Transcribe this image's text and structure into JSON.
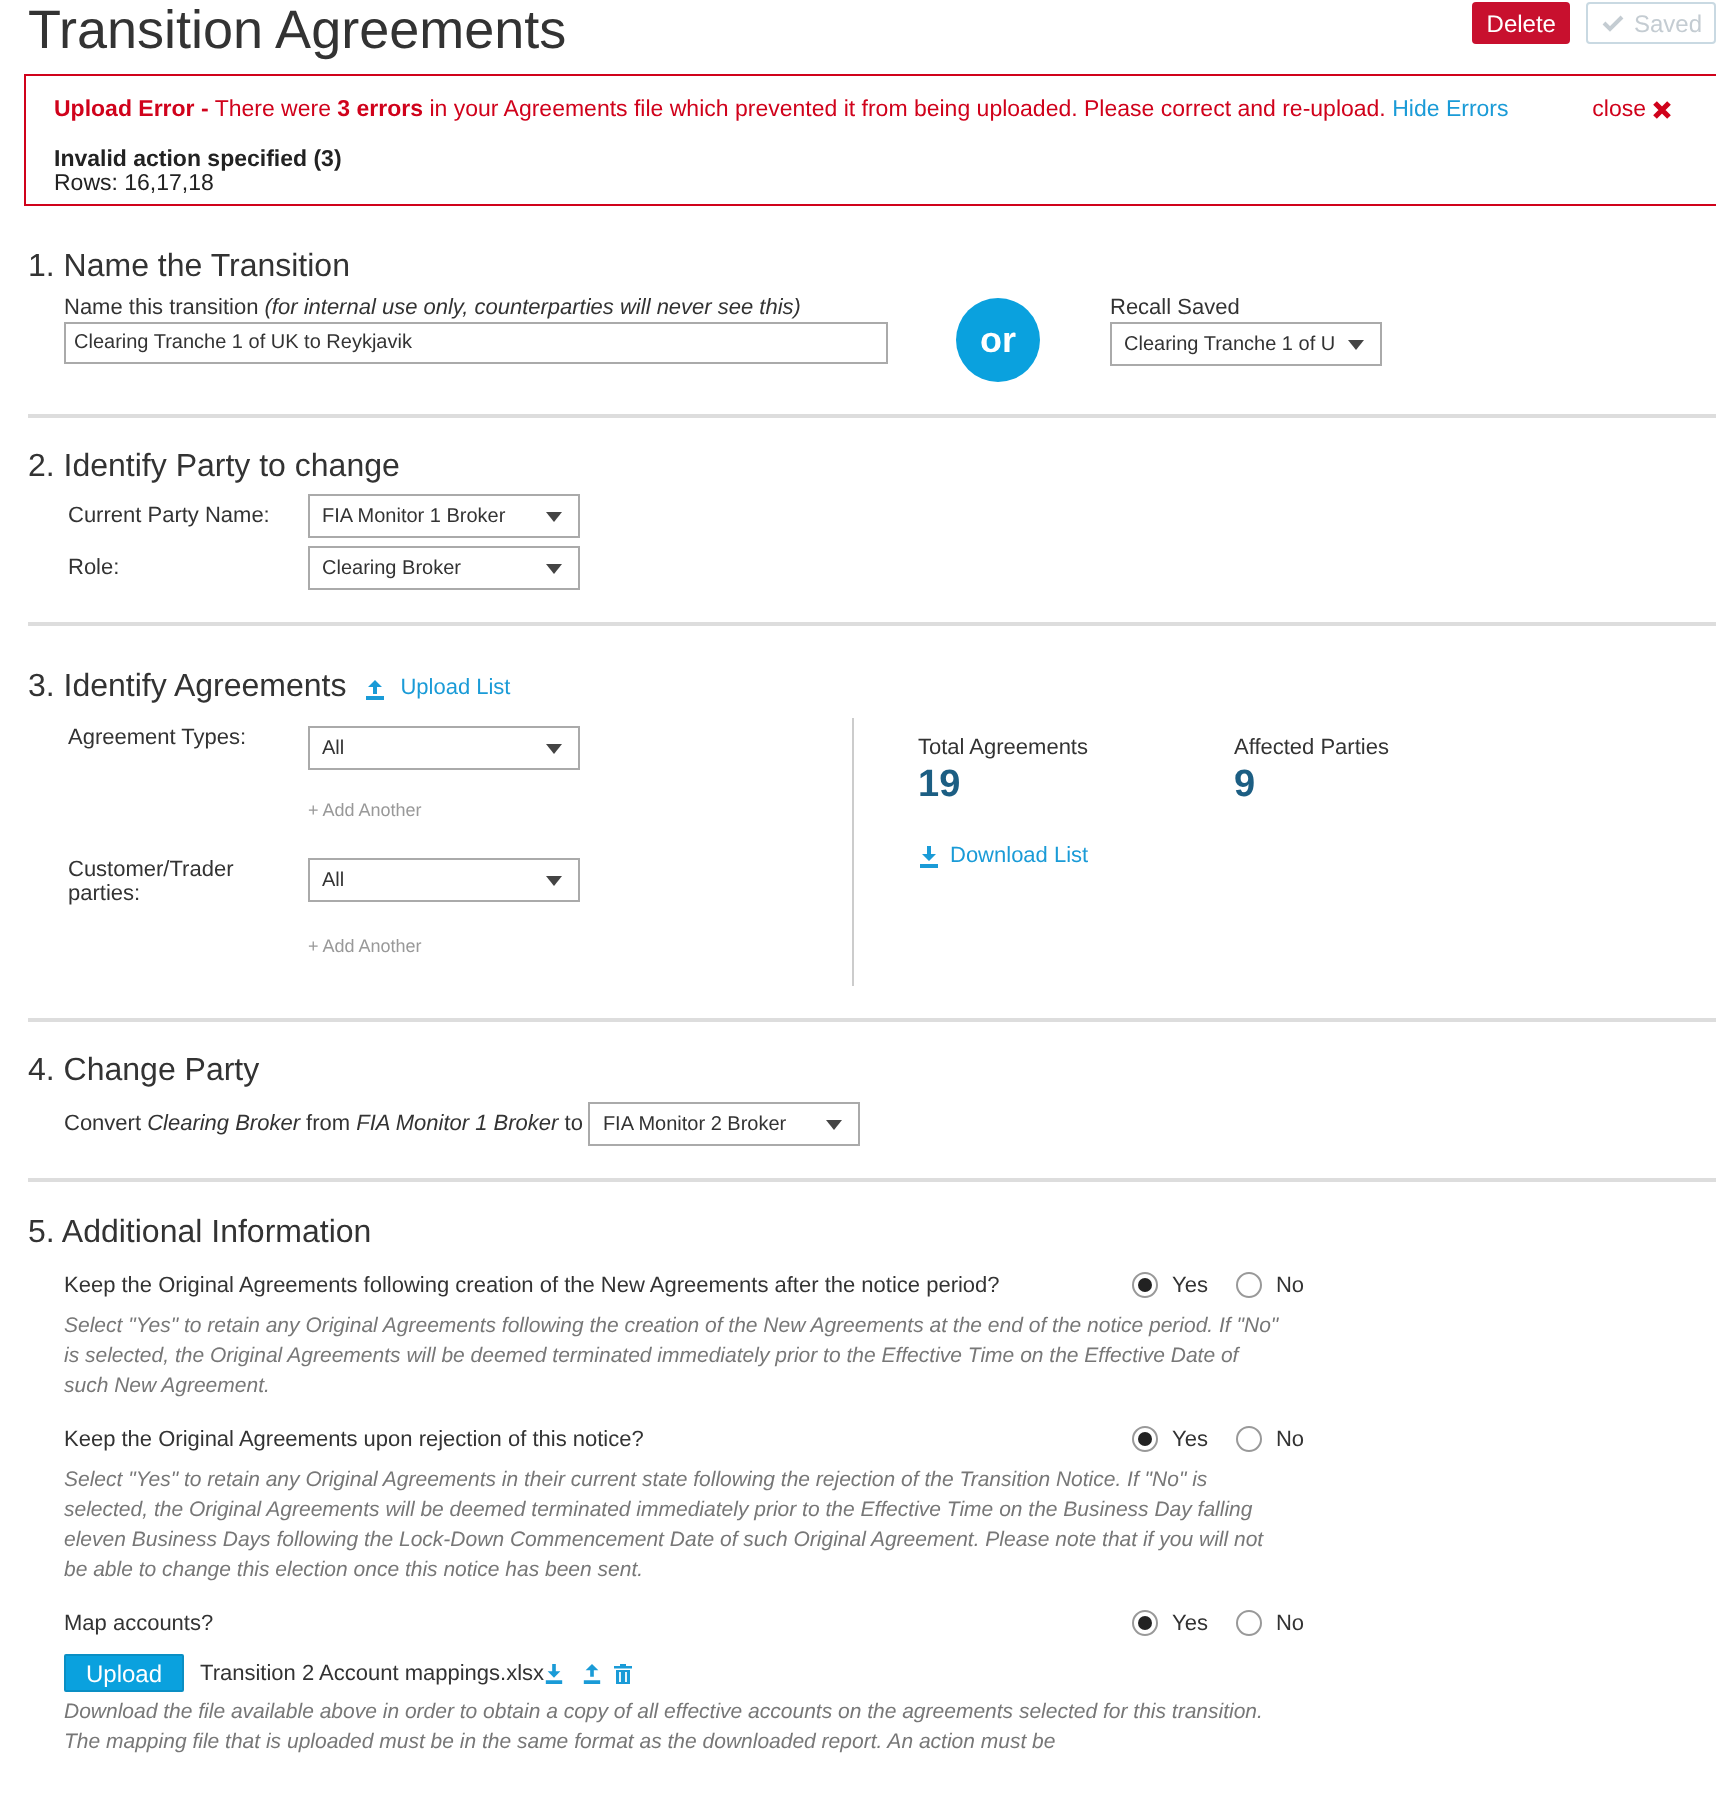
{
  "header": {
    "title": "Transition Agreements",
    "delete_button": "Delete",
    "saved_button": {
      "label": "Saved",
      "disabled": true
    }
  },
  "error": {
    "prefix": "Upload Error -",
    "message": "There were **3 errors** in your Agreements file which prevented it from being uploaded. Please correct and re-upload.",
    "link": "Hide Errors",
    "close": "close",
    "heading": "Invalid action specified (3)",
    "rows": "Rows: 16,17,18"
  },
  "name_section": {
    "heading": "1. Name the Transition",
    "label": "Name this transition",
    "note": "(for internal use only, counterparties will never see this)",
    "value": "Clearing Tranche 1 of UK to Reykjavik",
    "or": "or",
    "recall_label": "Recall Saved",
    "recall_value": "Clearing Tranche 1 of U"
  },
  "party_section": {
    "heading": "2. Identify Party to change",
    "fields": [
      {
        "label": "Current Party Name:",
        "value": "FIA Monitor 1 Broker"
      },
      {
        "label": "Role:",
        "value": "Clearing Broker"
      }
    ]
  },
  "agreements_section": {
    "heading": "3. Identify Agreements",
    "upload_link": "Upload List",
    "filters": [
      {
        "label": "Agreement Types:",
        "value": "All",
        "add": "+ Add Another"
      },
      {
        "label": "Customer/Trader parties:",
        "value": "All",
        "add": "+ Add Another"
      }
    ],
    "stats": [
      {
        "label": "Total Agreements",
        "value": "19"
      },
      {
        "label": "Affected Parties",
        "value": "9"
      }
    ],
    "download_link": "Download List"
  },
  "change_section": {
    "heading": "4. Change Party",
    "sentence": "Convert *Clearing Broker* from *FIA Monitor 1 Broker* to",
    "value": "FIA Monitor 2 Broker"
  },
  "additional_section": {
    "heading": "5. Additional Information",
    "questions": [
      {
        "question": "Keep the Original Agreements following creation of the New Agreements after the notice period?",
        "options": [
          {
            "label": "Yes",
            "selected": true
          },
          {
            "label": "No",
            "selected": false
          }
        ],
        "help": "Select \"Yes\" to retain any Original Agreements following the creation of the New Agreements at the end of the notice period. If \"No\" is selected, the Original Agreements will be deemed terminated immediately prior to the Effective Time on the Effective Date of such New Agreement."
      },
      {
        "question": "Keep the Original Agreements upon rejection of this notice?",
        "options": [
          {
            "label": "Yes",
            "selected": true
          },
          {
            "label": "No",
            "selected": false
          }
        ],
        "help": "Select \"Yes\" to retain any Original Agreements in their current state following the rejection of the Transition Notice. If \"No\" is selected, the Original Agreements will be deemed terminated immediately prior to the Effective Time on the Business Day falling eleven Business Days following the Lock-Down Commencement Date of such Original Agreement. Please note that if you will not be able to change this election once this notice has been sent."
      },
      {
        "question": "Map accounts?",
        "options": [
          {
            "label": "Yes",
            "selected": true
          },
          {
            "label": "No",
            "selected": false
          }
        ]
      }
    ],
    "upload_button": "Upload",
    "file_name": "Transition 2 Account mappings.xlsx",
    "upload_help": "Download the file available above in order to obtain a copy of all effective accounts on the agreements selected for this transition. The mapping file that is uploaded must be in the same format as the downloaded report. An action must be"
  }
}
